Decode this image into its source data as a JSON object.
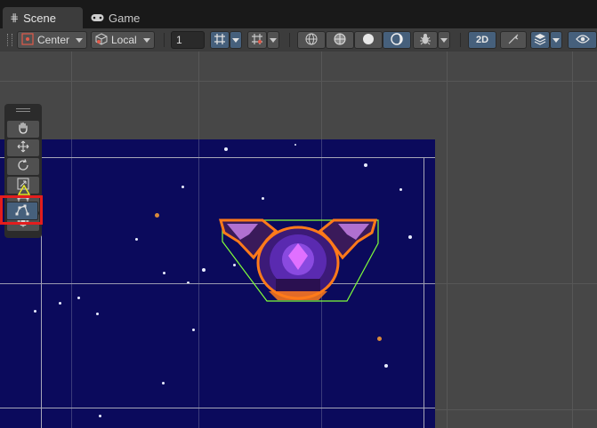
{
  "tabs": [
    {
      "label": "Scene",
      "icon": "grid-icon",
      "active": true
    },
    {
      "label": "Game",
      "icon": "gamepad-icon",
      "active": false
    }
  ],
  "toolbar": {
    "pivot_label": "Center",
    "space_label": "Local",
    "grid_size_value": "1",
    "two_d_label": "2D"
  },
  "tools": [
    "hand-tool",
    "move-tool",
    "rotate-tool",
    "scale-tool",
    "rect-tool",
    "transform-tool",
    "custom-editor-tool"
  ],
  "colors": {
    "accent_active": "#46607c",
    "space_background": "#0b0a5c",
    "highlight_box": "#e31d1d",
    "collider_outline": "#7fff3a",
    "sprite_outline": "#ff7a1a"
  }
}
